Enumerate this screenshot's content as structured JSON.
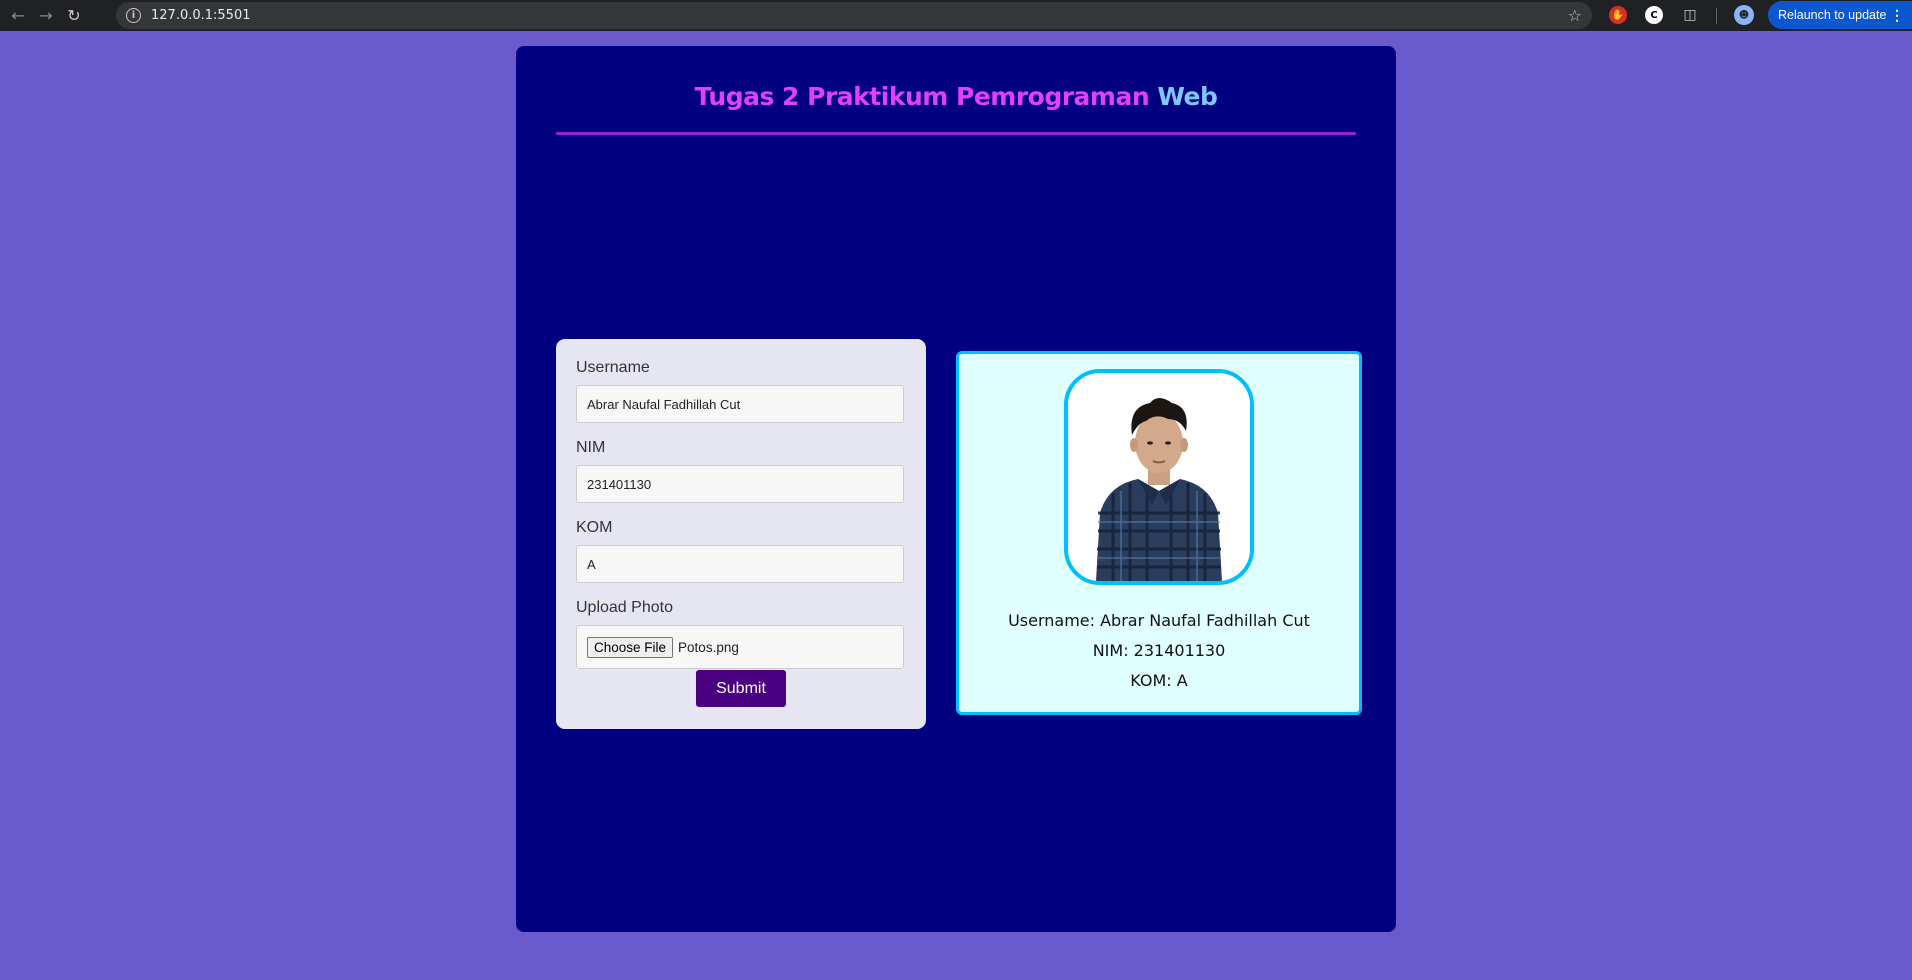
{
  "browser": {
    "url": "127.0.0.1:5501",
    "relaunch_label": "Relaunch to update"
  },
  "page": {
    "title_part1": "Tugas 2 Praktikum Pemrograman",
    "title_part2": "Web",
    "colors": {
      "background": "#6a5acd",
      "container": "#000080",
      "title_accent": "#e040fb",
      "title_secondary": "#7ec8ff",
      "card_border": "#00bfff",
      "submit": "#4b0082"
    }
  },
  "form": {
    "username_label": "Username",
    "username_value": "Abrar Naufal Fadhillah Cut",
    "nim_label": "NIM",
    "nim_value": "231401130",
    "kom_label": "KOM",
    "kom_value": "A",
    "upload_label": "Upload Photo",
    "file_button": "Choose File",
    "file_name": "Potos.png",
    "submit_label": "Submit"
  },
  "result": {
    "username_line": "Username: Abrar Naufal Fadhillah Cut",
    "nim_line": "NIM: 231401130",
    "kom_line": "KOM: A"
  }
}
